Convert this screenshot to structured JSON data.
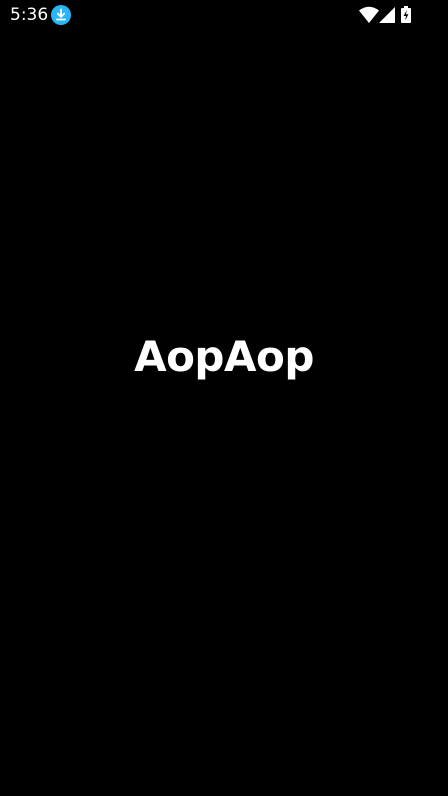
{
  "status_bar": {
    "time": "5:36",
    "icons": [
      "download-icon",
      "wifi-icon",
      "signal-icon",
      "battery-charging-icon"
    ],
    "download_icon_color": "#29B6F6"
  },
  "splash": {
    "logo_text": "AopAop"
  },
  "colors": {
    "background": "#000000",
    "foreground": "#ffffff"
  }
}
